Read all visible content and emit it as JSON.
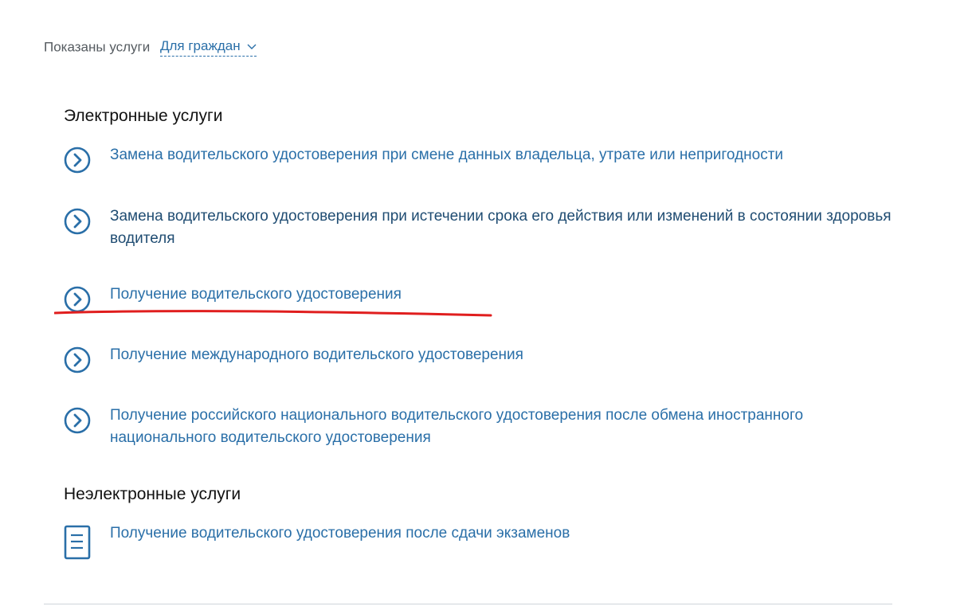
{
  "filter": {
    "prefix": "Показаны услуги",
    "selected": "Для граждан"
  },
  "sections": {
    "electronic": {
      "title": "Электронные услуги",
      "items": [
        {
          "label": "Замена водительского удостоверения при смене данных владельца, утрате или непригодности"
        },
        {
          "label": "Замена водительского удостоверения при истечении срока его действия или изменений в состоянии здоровья водителя"
        },
        {
          "label": "Получение водительского удостоверения"
        },
        {
          "label": "Получение международного водительского удостоверения"
        },
        {
          "label": "Получение российского национального водительского удостоверения после обмена иностранного национального водительского удостоверения"
        }
      ]
    },
    "non_electronic": {
      "title": "Неэлектронные услуги",
      "items": [
        {
          "label": "Получение водительского удостоверения после сдачи экзаменов"
        }
      ]
    }
  },
  "colors": {
    "link": "#2a6fa8",
    "icon": "#2a6fa8",
    "highlight_underline": "#e01e1e"
  },
  "icons": {
    "electronic_item": "circle-chevron-right-icon",
    "non_electronic_item": "document-icon"
  }
}
